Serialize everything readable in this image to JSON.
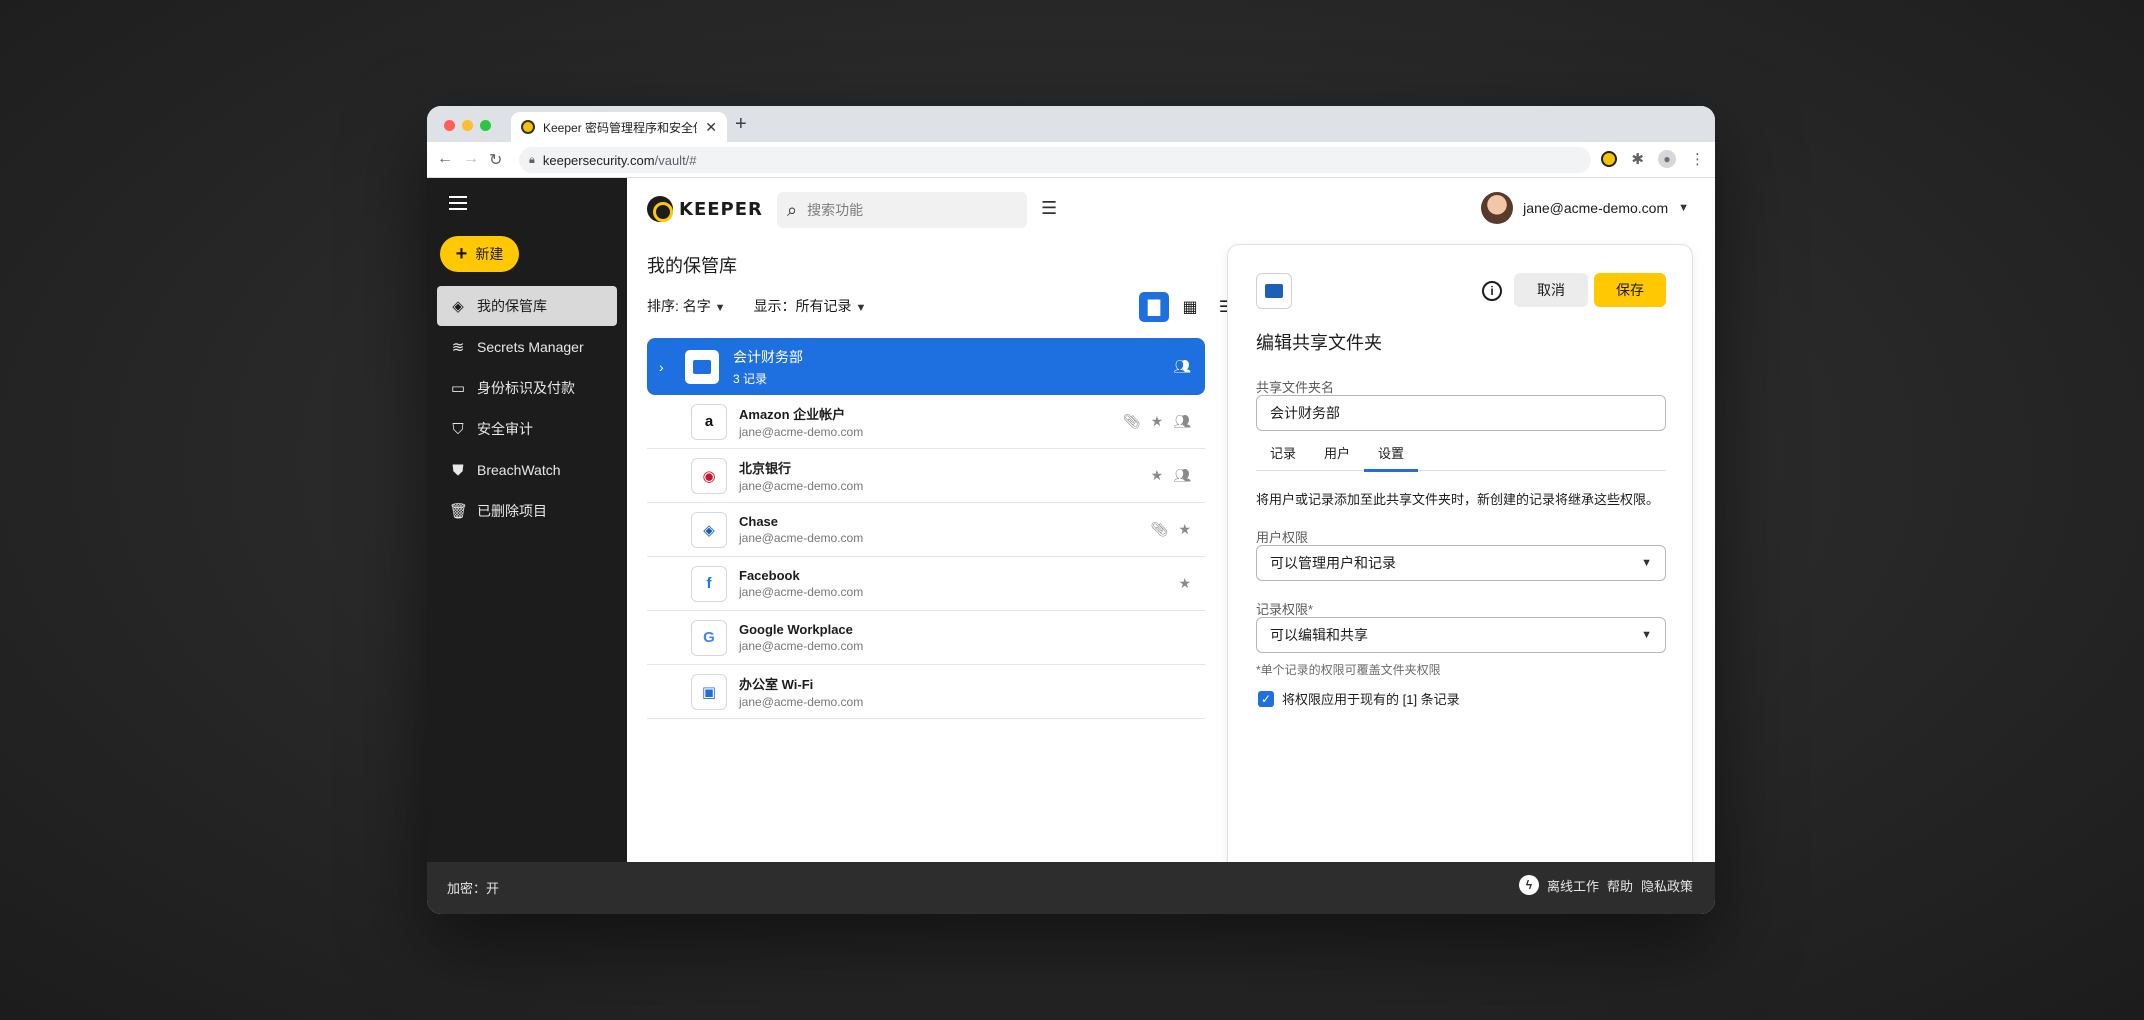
{
  "browser": {
    "tab_title": "Keeper 密码管理程序和安全保",
    "tab_close": "✕",
    "new_tab": "+",
    "url_host": "keepersecurity.com",
    "url_path": "/vault/#"
  },
  "sidebar": {
    "new_label": "新建",
    "items": [
      {
        "label": "我的保管库",
        "icon": "vault-icon"
      },
      {
        "label": "Secrets Manager",
        "icon": "layers-icon"
      },
      {
        "label": "身份标识及付款",
        "icon": "card-icon"
      },
      {
        "label": "安全审计",
        "icon": "shield-icon"
      },
      {
        "label": "BreachWatch",
        "icon": "breachwatch-icon"
      },
      {
        "label": "已删除项目",
        "icon": "trash-icon"
      }
    ]
  },
  "header": {
    "logo_text": "KEEPER",
    "search_placeholder": "搜索功能",
    "user_email": "jane@acme-demo.com"
  },
  "vault": {
    "title": "我的保管库",
    "sort_label": "排序: 名字",
    "show_label": "显示：所有记录",
    "folder": {
      "name": "会计财务部",
      "count": "3 记录"
    },
    "records": [
      {
        "name": "Amazon 企业帐户",
        "email": "jane@acme-demo.com",
        "logo": "a",
        "logo_color": "#111111"
      },
      {
        "name": "北京银行",
        "email": "jane@acme-demo.com",
        "logo": "◉",
        "logo_color": "#d0112b"
      },
      {
        "name": "Chase",
        "email": "jane@acme-demo.com",
        "logo": "◈",
        "logo_color": "#1a5fb4"
      },
      {
        "name": "Facebook",
        "email": "jane@acme-demo.com",
        "logo": "f",
        "logo_color": "#1877f2"
      },
      {
        "name": "Google Workplace",
        "email": "jane@acme-demo.com",
        "logo": "G",
        "logo_color": "#4285f4"
      },
      {
        "name": "办公室 Wi-Fi",
        "email": "jane@acme-demo.com",
        "logo": "▣",
        "logo_color": "#1e6fe0"
      }
    ]
  },
  "panel": {
    "info": "i",
    "cancel": "取消",
    "save": "保存",
    "title": "编辑共享文件夹",
    "name_label": "共享文件夹名",
    "name_value": "会计财务部",
    "tabs": [
      "记录",
      "用户",
      "设置"
    ],
    "description": "将用户或记录添加至此共享文件夹时，新创建的记录将继承这些权限。",
    "user_perm_label": "用户权限",
    "user_perm_value": "可以管理用户和记录",
    "record_perm_label": "记录权限*",
    "record_perm_value": "可以编辑和共享",
    "note": "*单个记录的权限可覆盖文件夹权限",
    "checkbox_label": "将权限应用于现有的 [1] 条记录"
  },
  "footer": {
    "encryption": "加密：开",
    "offline": "离线工作",
    "help": "帮助",
    "privacy": "隐私政策"
  },
  "colors": {
    "accent_blue": "#1e6fe0",
    "brand_yellow": "#ffc800",
    "sidebar_bg": "#1c1c1c"
  }
}
